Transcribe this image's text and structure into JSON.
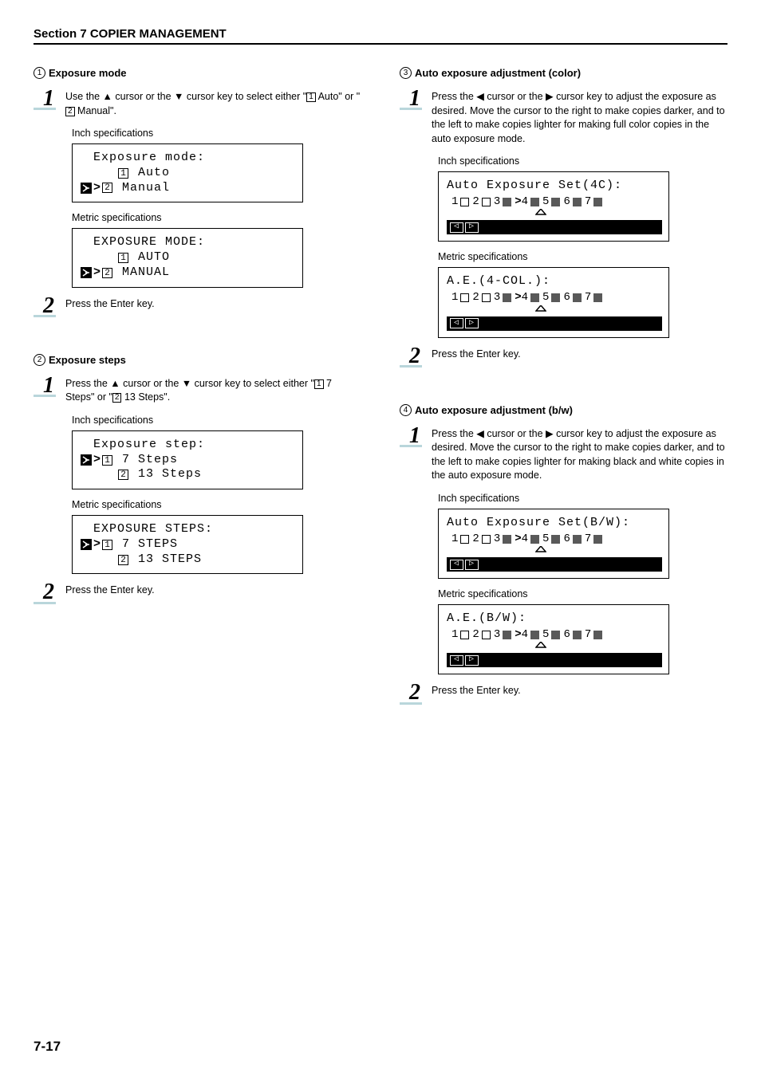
{
  "section_title": "Section 7  COPIER MANAGEMENT",
  "page_number": "7-17",
  "left": {
    "block1": {
      "num": "1",
      "title": "Exposure mode",
      "step1": {
        "pre": "Use the ▲ cursor or the ▼ cursor key to select either \"",
        "opt1num": "1",
        "opt1": " Auto\" or \"",
        "opt2num": "2",
        "opt2": " Manual\"."
      },
      "inch_label": "Inch specifications",
      "inch_lcd": {
        "title": "Exposure mode:",
        "l1_num": "1",
        "l1_txt": " Auto",
        "l2_num": "2",
        "l2_txt": " Manual"
      },
      "metric_label": "Metric specifications",
      "metric_lcd": {
        "title": "EXPOSURE MODE:",
        "l1_num": "1",
        "l1_txt": " AUTO",
        "l2_num": "2",
        "l2_txt": " MANUAL"
      },
      "step2": "Press the Enter key."
    },
    "block2": {
      "num": "2",
      "title": "Exposure steps",
      "step1": {
        "pre": "Press the ▲ cursor or the ▼ cursor key to select either \"",
        "opt1num": "1",
        "opt1": " 7 Steps\" or \"",
        "opt2num": "2",
        "opt2": " 13 Steps\"."
      },
      "inch_label": "Inch specifications",
      "inch_lcd": {
        "title": "Exposure step:",
        "l1_num": "1",
        "l1_txt": " 7 Steps",
        "l2_num": "2",
        "l2_txt": " 13 Steps"
      },
      "metric_label": "Metric specifications",
      "metric_lcd": {
        "title": "EXPOSURE STEPS:",
        "l1_num": "1",
        "l1_txt": " 7 STEPS",
        "l2_num": "2",
        "l2_txt": " 13 STEPS"
      },
      "step2": "Press the Enter key."
    }
  },
  "right": {
    "block3": {
      "num": "3",
      "title": "Auto exposure adjustment (color)",
      "step1": "Press the ◀ cursor or the ▶ cursor key to adjust the exposure as desired. Move the cursor to the right to make copies darker, and to the left to make copies lighter for making full color copies in the auto exposure mode.",
      "inch_label": "Inch specifications",
      "inch_lcd_title": "Auto Exposure Set(4C):",
      "metric_label": "Metric specifications",
      "metric_lcd_title": "A.E.(4-COL.):",
      "step2": "Press the Enter key."
    },
    "block4": {
      "num": "4",
      "title": "Auto exposure adjustment (b/w)",
      "step1": "Press the ◀ cursor or the ▶ cursor key to adjust the exposure as desired. Move the cursor to the right to make copies darker, and to the left to make copies lighter for making black and white copies in the auto exposure mode.",
      "inch_label": "Inch specifications",
      "inch_lcd_title": "Auto Exposure Set(B/W):",
      "metric_label": "Metric specifications",
      "metric_lcd_title": "A.E.(B/W):",
      "step2": "Press the Enter key."
    }
  },
  "scale": {
    "values": [
      "1",
      "2",
      "3",
      "4",
      "5",
      "6",
      "7"
    ],
    "selected_index": 3
  }
}
